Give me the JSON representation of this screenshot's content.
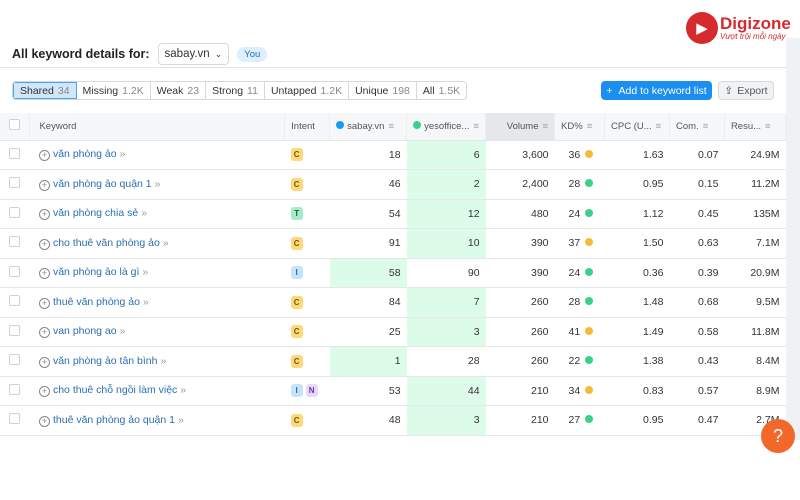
{
  "brand": {
    "name": "Digizone",
    "tagline": "Vượt trội mỗi ngày",
    "color": "#d72a2e"
  },
  "header": {
    "title": "All keyword details for:",
    "domain": "sabay.vn",
    "you_badge": "You"
  },
  "tabs": [
    {
      "label": "Shared",
      "count": "34",
      "active": true
    },
    {
      "label": "Missing",
      "count": "1.2K"
    },
    {
      "label": "Weak",
      "count": "23"
    },
    {
      "label": "Strong",
      "count": "11"
    },
    {
      "label": "Untapped",
      "count": "1.2K"
    },
    {
      "label": "Unique",
      "count": "198"
    },
    {
      "label": "All",
      "count": "1.5K"
    }
  ],
  "actions": {
    "add": "Add to keyword list",
    "export": "Export"
  },
  "columns": {
    "keyword": "Keyword",
    "intent": "Intent",
    "d1": "sabay.vn",
    "d2": "yesoffice...",
    "volume": "Volume",
    "kd": "KD%",
    "cpc": "CPC (U...",
    "com": "Com.",
    "results": "Resu..."
  },
  "colors": {
    "d1": "#1a9af0",
    "d2": "#3ccf8e",
    "kd_yellow": "#f6b93b",
    "kd_green": "#3ccf8e"
  },
  "rows": [
    {
      "keyword": "văn phòng ảo",
      "intent": [
        "C"
      ],
      "d1": "18",
      "d2": "6",
      "better": "d2",
      "volume": "3,600",
      "kd": "36",
      "kd_color": "yellow",
      "cpc": "1.63",
      "com": "0.07",
      "results": "24.9M"
    },
    {
      "keyword": "văn phòng ảo quận 1",
      "intent": [
        "C"
      ],
      "d1": "46",
      "d2": "2",
      "better": "d2",
      "volume": "2,400",
      "kd": "28",
      "kd_color": "green",
      "cpc": "0.95",
      "com": "0.15",
      "results": "11.2M"
    },
    {
      "keyword": "văn phòng chia sẻ",
      "intent": [
        "T"
      ],
      "d1": "54",
      "d2": "12",
      "better": "d2",
      "volume": "480",
      "kd": "24",
      "kd_color": "green",
      "cpc": "1.12",
      "com": "0.45",
      "results": "135M"
    },
    {
      "keyword": "cho thuê văn phòng ảo",
      "intent": [
        "C"
      ],
      "d1": "91",
      "d2": "10",
      "better": "d2",
      "volume": "390",
      "kd": "37",
      "kd_color": "yellow",
      "cpc": "1.50",
      "com": "0.63",
      "results": "7.1M"
    },
    {
      "keyword": "văn phòng ảo là gì",
      "intent": [
        "I"
      ],
      "d1": "58",
      "d2": "90",
      "better": "d1",
      "volume": "390",
      "kd": "24",
      "kd_color": "green",
      "cpc": "0.36",
      "com": "0.39",
      "results": "20.9M"
    },
    {
      "keyword": "thuê văn phòng ảo",
      "intent": [
        "C"
      ],
      "d1": "84",
      "d2": "7",
      "better": "d2",
      "volume": "260",
      "kd": "28",
      "kd_color": "green",
      "cpc": "1.48",
      "com": "0.68",
      "results": "9.5M"
    },
    {
      "keyword": "van phong ao",
      "intent": [
        "C"
      ],
      "d1": "25",
      "d2": "3",
      "better": "d2",
      "volume": "260",
      "kd": "41",
      "kd_color": "yellow",
      "cpc": "1.49",
      "com": "0.58",
      "results": "11.8M"
    },
    {
      "keyword": "văn phòng ảo tân bình",
      "intent": [
        "C"
      ],
      "d1": "1",
      "d2": "28",
      "better": "d1",
      "volume": "260",
      "kd": "22",
      "kd_color": "green",
      "cpc": "1.38",
      "com": "0.43",
      "results": "8.4M"
    },
    {
      "keyword": "cho thuê chỗ ngồi làm việc",
      "intent": [
        "I",
        "N"
      ],
      "d1": "53",
      "d2": "44",
      "better": "d2",
      "volume": "210",
      "kd": "34",
      "kd_color": "yellow",
      "cpc": "0.83",
      "com": "0.57",
      "results": "8.9M"
    },
    {
      "keyword": "thuê văn phòng ảo quận 1",
      "intent": [
        "C"
      ],
      "d1": "48",
      "d2": "3",
      "better": "d2",
      "volume": "210",
      "kd": "27",
      "kd_color": "green",
      "cpc": "0.95",
      "com": "0.47",
      "results": "2.7M"
    }
  ],
  "help": "?"
}
